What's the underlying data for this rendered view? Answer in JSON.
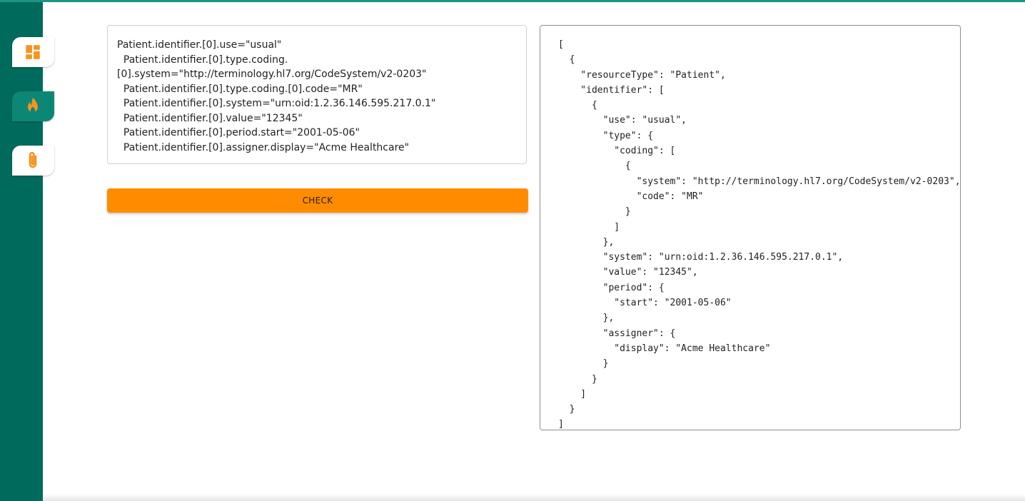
{
  "sidebar": {
    "items": [
      {
        "icon": "dashboard-icon",
        "active": false
      },
      {
        "icon": "fire-icon",
        "active": true
      },
      {
        "icon": "paperclip-icon",
        "active": false
      }
    ]
  },
  "input": {
    "lines": [
      "Patient.identifier.[0].use=\"usual\"",
      "  Patient.identifier.[0].type.coding.",
      "[0].system=\"http://terminology.hl7.org/CodeSystem/v2-0203\"",
      "  Patient.identifier.[0].type.coding.[0].code=\"MR\"",
      "  Patient.identifier.[0].system=\"urn:oid:1.2.36.146.595.217.0.1\"",
      "  Patient.identifier.[0].value=\"12345\"",
      "  Patient.identifier.[0].period.start=\"2001-05-06\"",
      "  Patient.identifier.[0].assigner.display=\"Acme Healthcare\""
    ]
  },
  "check_button": {
    "label": "CHECK"
  },
  "output": {
    "json_text": "[\n  {\n    \"resourceType\": \"Patient\",\n    \"identifier\": [\n      {\n        \"use\": \"usual\",\n        \"type\": {\n          \"coding\": [\n            {\n              \"system\": \"http://terminology.hl7.org/CodeSystem/v2-0203\",\n              \"code\": \"MR\"\n            }\n          ]\n        },\n        \"system\": \"urn:oid:1.2.36.146.595.217.0.1\",\n        \"value\": \"12345\",\n        \"period\": {\n          \"start\": \"2001-05-06\"\n        },\n        \"assigner\": {\n          \"display\": \"Acme Healthcare\"\n        }\n      }\n    ]\n  }\n]"
  },
  "colors": {
    "sidebar": "#006a5c",
    "accent": "#ff8c00",
    "topbar": "#1a9585"
  }
}
